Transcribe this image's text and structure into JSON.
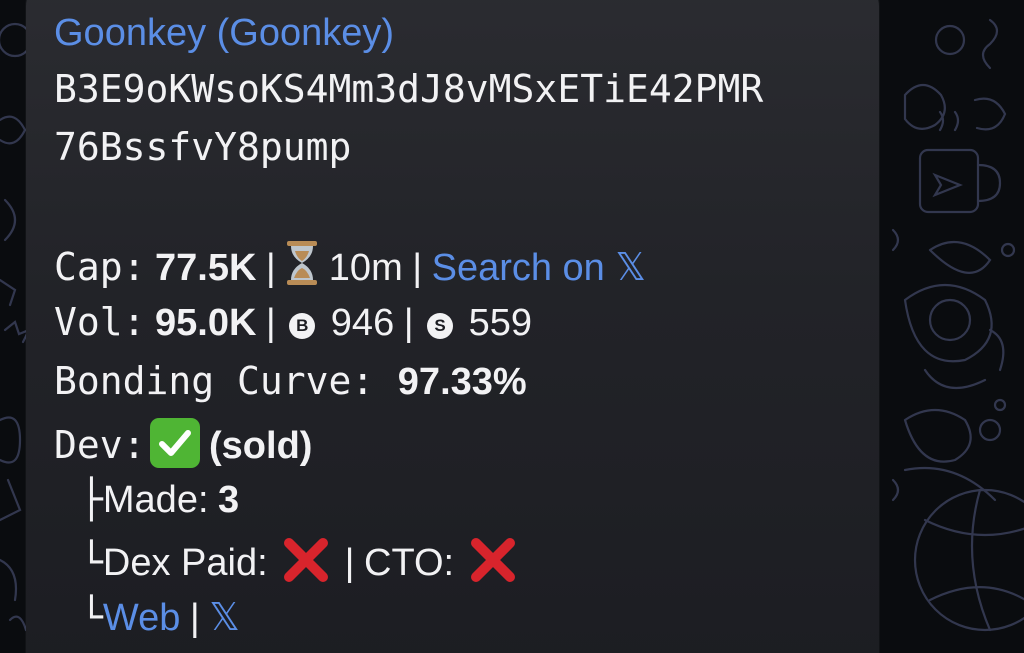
{
  "message": {
    "title": "Goonkey (Goonkey)",
    "address_line1": "B3E9oKWsoKS4Mm3dJ8vMSxETiE42PMR",
    "address_line2": "76BssfvY8pump",
    "cap": {
      "label": "Cap:",
      "value": "77.5K",
      "sep1": "|",
      "age": "10m",
      "sep2": "|",
      "search_link": "Search on",
      "x_glyph": "𝕏"
    },
    "vol": {
      "label": "Vol:",
      "value": "95.0K",
      "sep1": "|",
      "buy_coin": "B",
      "buys": "946",
      "sep2": "|",
      "sell_coin": "S",
      "sells": "559"
    },
    "bonding": {
      "label": "Bonding Curve:",
      "value": "97.33%"
    },
    "dev": {
      "label": "Dev:",
      "status": "(sold)",
      "made_prefix": "├",
      "made_label": "Made:",
      "made_value": "3",
      "dex_prefix": "└",
      "dex_label": "Dex Paid:",
      "sep": "|",
      "cto_label": "CTO:",
      "links_prefix": "└",
      "web_link": "Web",
      "links_sep": "|",
      "x_link": "𝕏"
    }
  },
  "icons": {
    "hourglass": "hourglass-icon",
    "check": "check-icon",
    "cross": "cross-icon",
    "buy": "buy-coin-icon",
    "sell": "sell-coin-icon"
  },
  "colors": {
    "link": "#5b8ee6",
    "text": "#f2f2f4",
    "bubble": "#222328",
    "check_bg": "#4fb534",
    "cross": "#d8242c"
  }
}
